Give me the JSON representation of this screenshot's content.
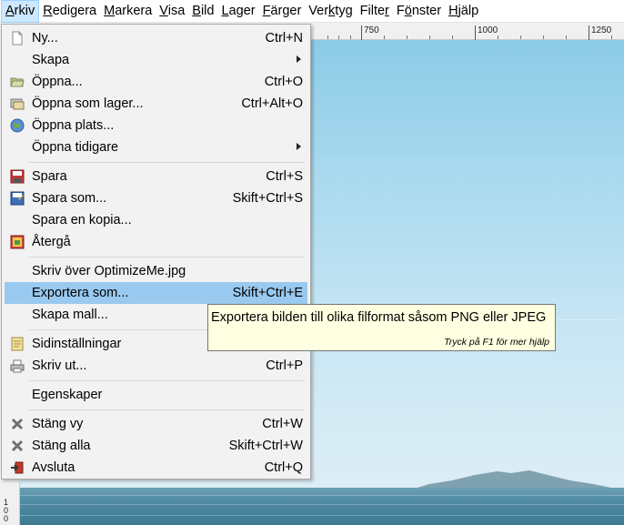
{
  "menubar": {
    "items": [
      {
        "label": "Arkiv",
        "active": true
      },
      {
        "label": "Redigera"
      },
      {
        "label": "Markera"
      },
      {
        "label": "Visa"
      },
      {
        "label": "Bild"
      },
      {
        "label": "Lager"
      },
      {
        "label": "Färger"
      },
      {
        "label": "Verktyg"
      },
      {
        "label": "Filter"
      },
      {
        "label": "Fönster"
      },
      {
        "label": "Hjälp"
      }
    ]
  },
  "ruler": {
    "top_labels": [
      "750",
      "1000",
      "1250"
    ],
    "left_label": "1\n0\n0"
  },
  "file_menu": {
    "items": [
      {
        "label": "Ny...",
        "shortcut": "Ctrl+N",
        "icon": "new-document-icon"
      },
      {
        "label": "Skapa",
        "shortcut": "",
        "submenu": true
      },
      {
        "label": "Öppna...",
        "shortcut": "Ctrl+O",
        "icon": "open-folder-icon"
      },
      {
        "label": "Öppna som lager...",
        "shortcut": "Ctrl+Alt+O",
        "icon": "open-as-layer-icon"
      },
      {
        "label": "Öppna plats...",
        "shortcut": "",
        "icon": "globe-icon"
      },
      {
        "label": "Öppna tidigare",
        "shortcut": "",
        "submenu": true
      },
      {
        "label": "Spara",
        "shortcut": "Ctrl+S",
        "icon": "save-icon"
      },
      {
        "label": "Spara som...",
        "shortcut": "Skift+Ctrl+S",
        "icon": "save-as-icon"
      },
      {
        "label": "Spara en kopia...",
        "shortcut": ""
      },
      {
        "label": "Återgå",
        "shortcut": "",
        "icon": "revert-icon"
      },
      {
        "label": "Skriv över OptimizeMe.jpg",
        "shortcut": ""
      },
      {
        "label": "Exportera som...",
        "shortcut": "Skift+Ctrl+E",
        "highlighted": true
      },
      {
        "label": "Skapa mall...",
        "shortcut": ""
      },
      {
        "label": "Sidinställningar",
        "shortcut": "",
        "icon": "page-setup-icon"
      },
      {
        "label": "Skriv ut...",
        "shortcut": "Ctrl+P",
        "icon": "printer-icon"
      },
      {
        "label": "Egenskaper",
        "shortcut": ""
      },
      {
        "label": "Stäng vy",
        "shortcut": "Ctrl+W",
        "icon": "close-icon"
      },
      {
        "label": "Stäng alla",
        "shortcut": "Skift+Ctrl+W",
        "icon": "close-all-icon"
      },
      {
        "label": "Avsluta",
        "shortcut": "Ctrl+Q",
        "icon": "quit-icon"
      }
    ]
  },
  "tooltip": {
    "text": "Exportera bilden till olika filformat såsom PNG eller JPEG",
    "help": "Tryck på F1 för mer hjälp"
  },
  "colors": {
    "highlight": "#99c9ef",
    "menubar_active": "#cce8ff",
    "tooltip_bg": "#ffffe1"
  }
}
